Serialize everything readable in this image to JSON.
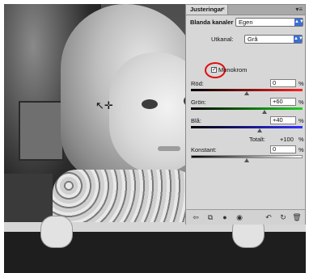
{
  "panel": {
    "tab_label": "Justeringar",
    "tab_close": "×",
    "menu_icon": "▾≡",
    "preset_label": "Blanda kanaler",
    "preset_value": "Egen",
    "output_label": "Utkanal:",
    "output_value": "Grå",
    "monochrome_label": "Monokrom",
    "monochrome_checked": true
  },
  "channels": {
    "red": {
      "label": "Röd:",
      "value": "0",
      "unit": "%",
      "level": 0.5,
      "gradient": [
        "#000000",
        "#ff2020"
      ]
    },
    "green": {
      "label": "Grön:",
      "value": "+60",
      "unit": "%",
      "level": 0.8,
      "gradient": [
        "#000000",
        "#20d020"
      ]
    },
    "blue": {
      "label": "Blå:",
      "value": "+40",
      "unit": "%",
      "level": 0.7,
      "gradient": [
        "#000000",
        "#3030ff"
      ]
    }
  },
  "total": {
    "label": "Totalt:",
    "value": "+100",
    "unit": "%"
  },
  "constant": {
    "label": "Konstant:",
    "value": "0",
    "unit": "%",
    "level": 0.5
  },
  "toolbar": {
    "back": "⇦",
    "clip": "⧉",
    "visibility": "●",
    "eye": "◉",
    "reset_prev": "↶",
    "reset": "↻",
    "delete": "🗑"
  },
  "cursor_glyph": "↖✛",
  "colors": {
    "panel_bg": "#d7d7d7",
    "select_arrow": "#3d6fd2",
    "highlight": "#e01010"
  }
}
